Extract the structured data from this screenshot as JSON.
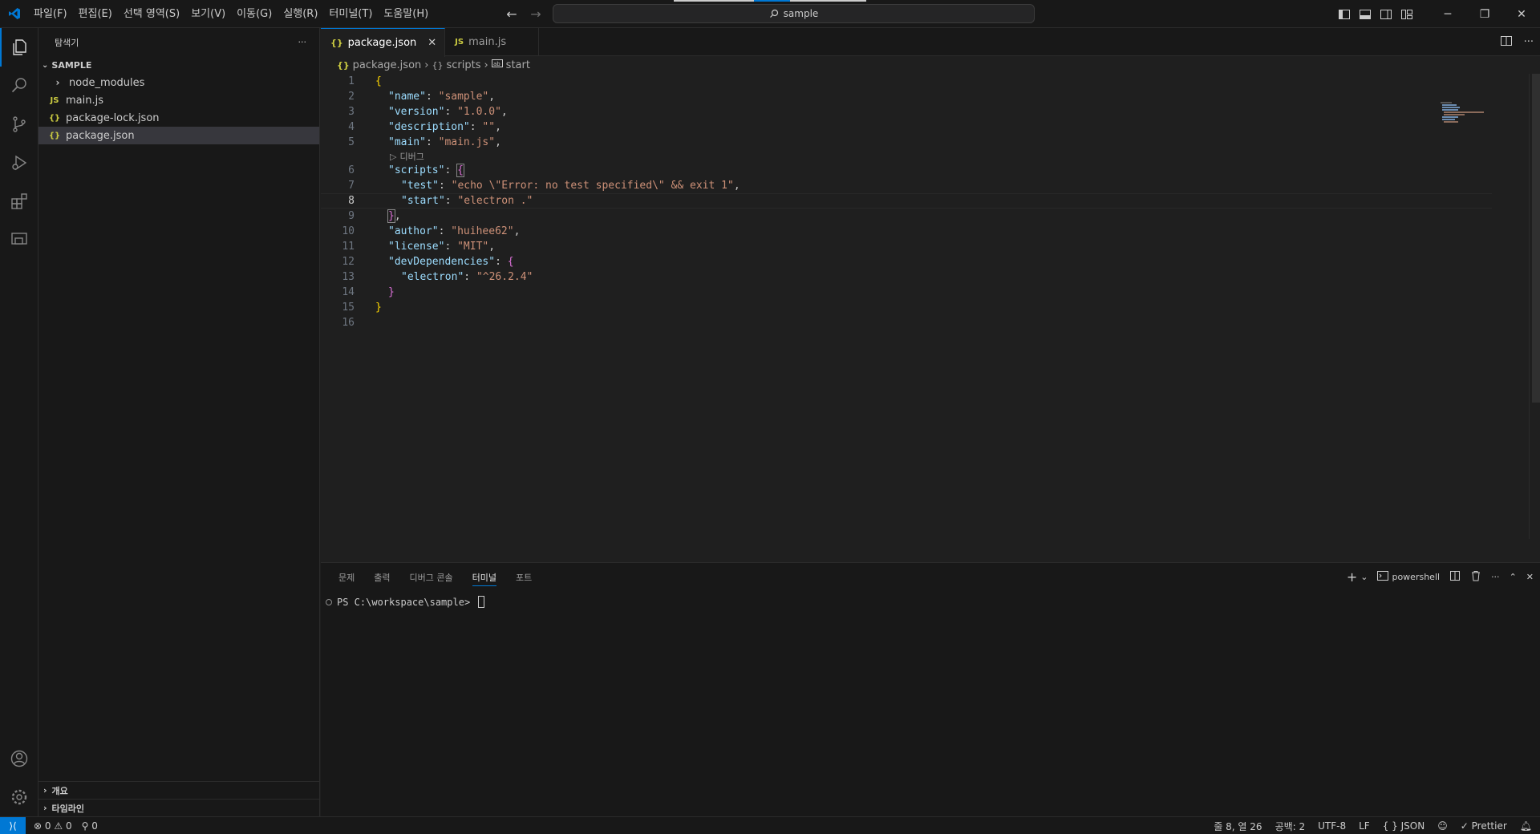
{
  "menu": [
    "파일(F)",
    "편집(E)",
    "선택 영역(S)",
    "보기(V)",
    "이동(G)",
    "실행(R)",
    "터미널(T)",
    "도움말(H)"
  ],
  "command_center": {
    "text": "sample"
  },
  "sidebar": {
    "title": "탐색기",
    "section": "SAMPLE",
    "items": [
      {
        "label": "node_modules",
        "type": "folder"
      },
      {
        "label": "main.js",
        "type": "js",
        "icon": "JS"
      },
      {
        "label": "package-lock.json",
        "type": "json",
        "icon": "{}"
      },
      {
        "label": "package.json",
        "type": "json",
        "icon": "{}",
        "selected": true
      }
    ],
    "outline": "개요",
    "timeline": "타임라인"
  },
  "tabs": [
    {
      "label": "package.json",
      "icon": "{}",
      "active": true
    },
    {
      "label": "main.js",
      "icon": "JS",
      "active": false
    }
  ],
  "breadcrumb": {
    "file": "package.json",
    "scripts": "scripts",
    "start": "start",
    "file_icon": "{}",
    "scripts_icon": "{}"
  },
  "codelens": "디버그",
  "line_numbers": [
    "1",
    "2",
    "3",
    "4",
    "5",
    "6",
    "7",
    "8",
    "9",
    "10",
    "11",
    "12",
    "13",
    "14",
    "15",
    "16"
  ],
  "code": {
    "name_key": "\"name\"",
    "name_val": "\"sample\"",
    "version_key": "\"version\"",
    "version_val": "\"1.0.0\"",
    "desc_key": "\"description\"",
    "desc_val": "\"\"",
    "main_key": "\"main\"",
    "main_val": "\"main.js\"",
    "scripts_key": "\"scripts\"",
    "test_key": "\"test\"",
    "test_val": "\"echo \\\"Error: no test specified\\\" && exit 1\"",
    "start_key": "\"start\"",
    "start_val": "\"electron .\"",
    "author_key": "\"author\"",
    "author_val": "\"huihee62\"",
    "license_key": "\"license\"",
    "license_val": "\"MIT\"",
    "devdeps_key": "\"devDependencies\"",
    "electron_key": "\"electron\"",
    "electron_val": "\"^26.2.4\""
  },
  "panel": {
    "tabs": [
      "문제",
      "출력",
      "디버그 콘솔",
      "터미널",
      "포트"
    ],
    "active_tab": "터미널",
    "shell": "powershell",
    "prompt": "PS C:\\workspace\\sample>"
  },
  "status": {
    "errors": "0",
    "warnings": "0",
    "ports": "0",
    "position": "줄 8, 열 26",
    "spaces": "공백: 2",
    "encoding": "UTF-8",
    "eol": "LF",
    "language": "JSON",
    "formatter": "Prettier"
  },
  "colors": {
    "accent": "#0078d4",
    "bg": "#1f1f1f",
    "sidebar_bg": "#181818"
  }
}
